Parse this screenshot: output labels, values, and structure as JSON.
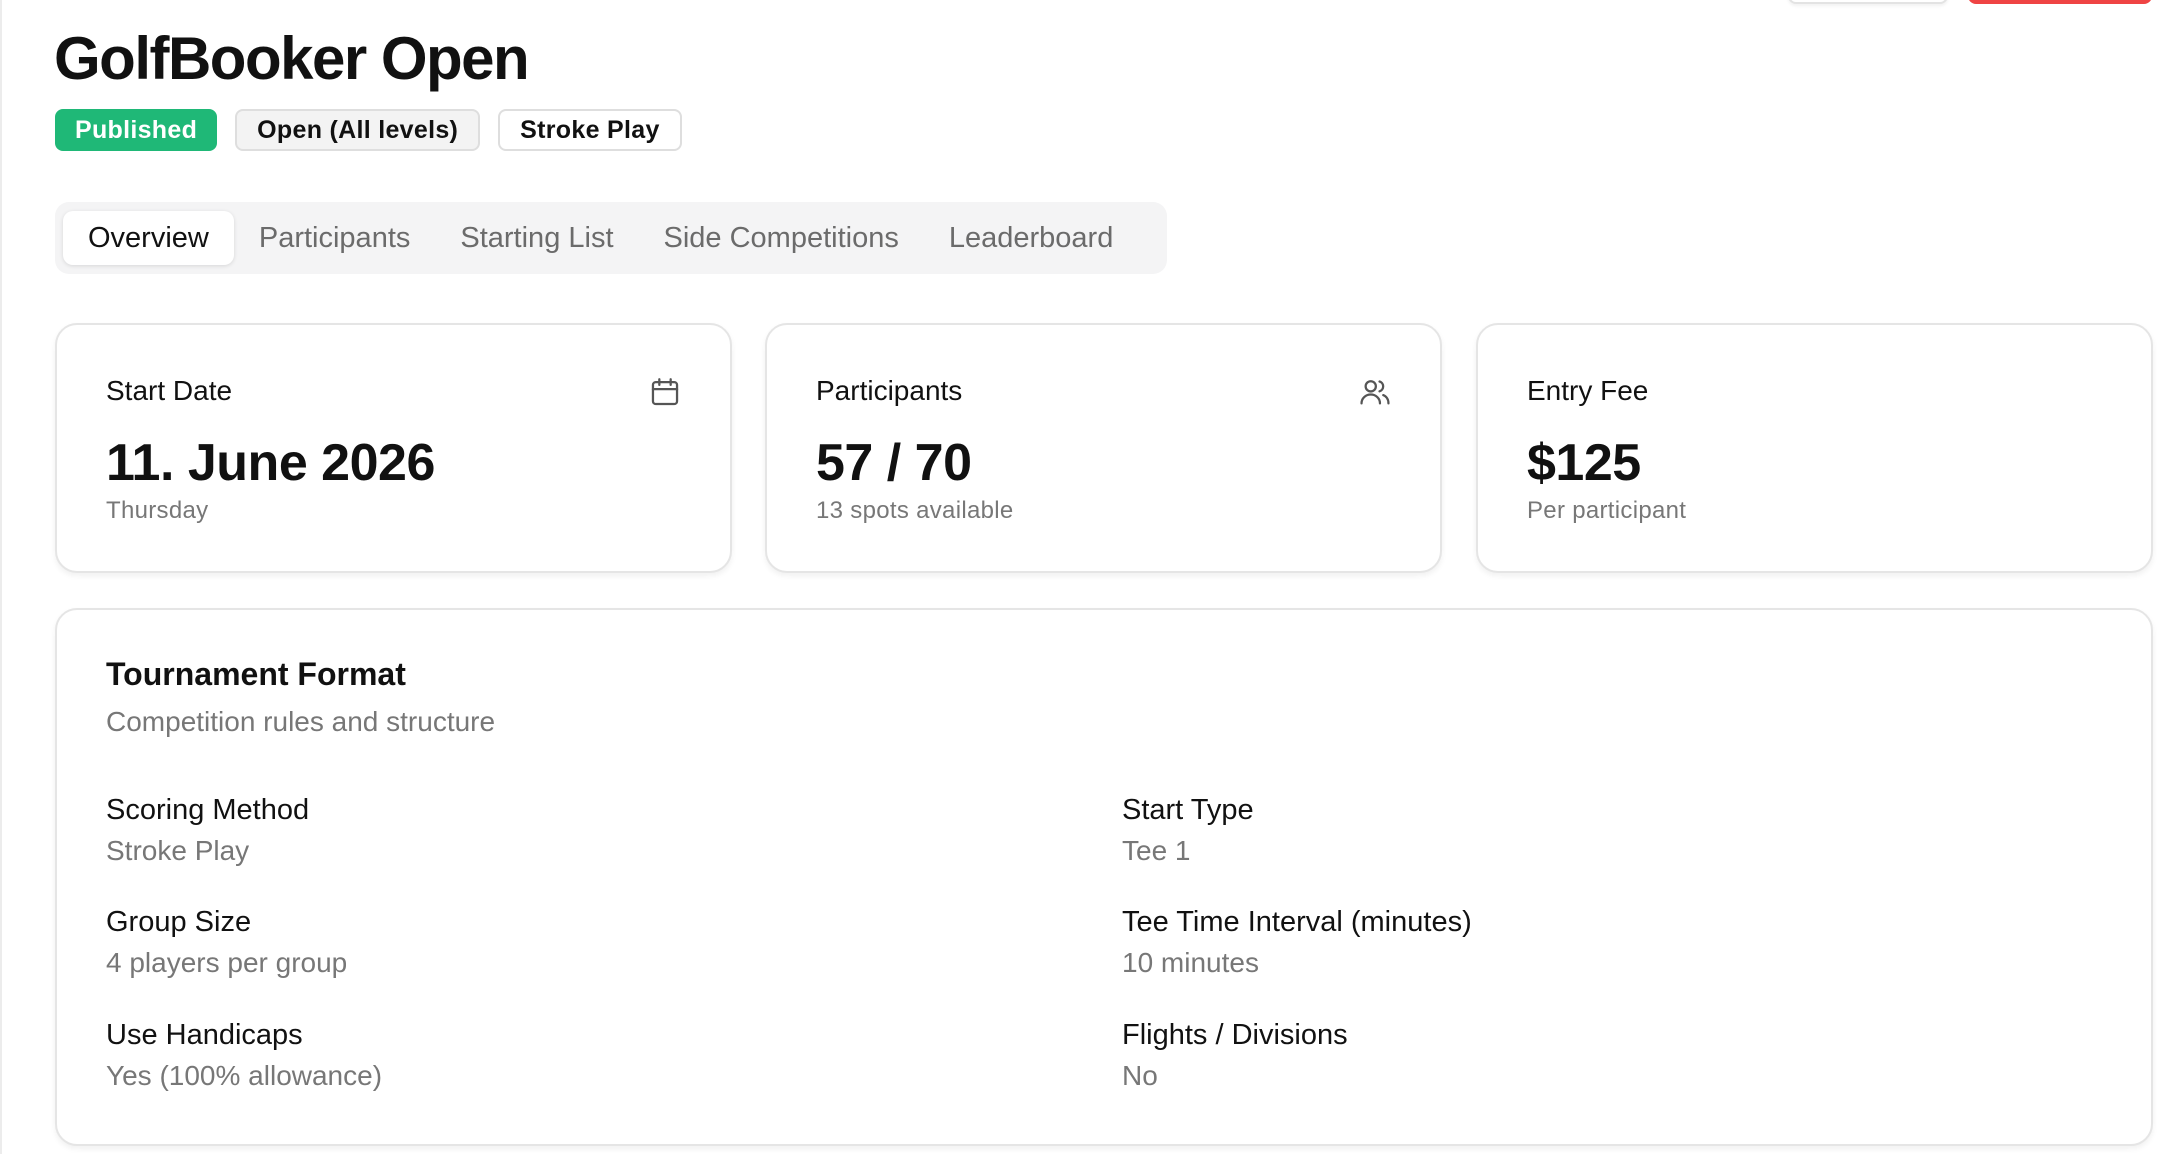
{
  "tournament": {
    "title": "GolfBooker Open",
    "badges": {
      "status": "Published",
      "level": "Open (All levels)",
      "format": "Stroke Play"
    }
  },
  "tabs": [
    {
      "label": "Overview",
      "active": true
    },
    {
      "label": "Participants",
      "active": false
    },
    {
      "label": "Starting List",
      "active": false
    },
    {
      "label": "Side Competitions",
      "active": false
    },
    {
      "label": "Leaderboard",
      "active": false
    }
  ],
  "stats": {
    "start_date": {
      "label": "Start Date",
      "value": "11. June 2026",
      "sub": "Thursday",
      "icon": "calendar-icon"
    },
    "participants": {
      "label": "Participants",
      "value": "57 / 70",
      "sub": "13 spots available",
      "icon": "users-icon"
    },
    "entry_fee": {
      "label": "Entry Fee",
      "value": "$125",
      "sub": "Per participant"
    }
  },
  "format": {
    "title": "Tournament Format",
    "subtitle": "Competition rules and structure",
    "fields": {
      "scoring_method": {
        "label": "Scoring Method",
        "value": "Stroke Play"
      },
      "start_type": {
        "label": "Start Type",
        "value": "Tee 1"
      },
      "group_size": {
        "label": "Group Size",
        "value": "4 players per group"
      },
      "tee_interval": {
        "label": "Tee Time Interval (minutes)",
        "value": "10 minutes"
      },
      "handicaps": {
        "label": "Use Handicaps",
        "value": "Yes (100% allowance)"
      },
      "flights": {
        "label": "Flights / Divisions",
        "value": "No"
      }
    }
  },
  "colors": {
    "published_badge": "#1fb877",
    "danger_button": "#ef4444"
  }
}
